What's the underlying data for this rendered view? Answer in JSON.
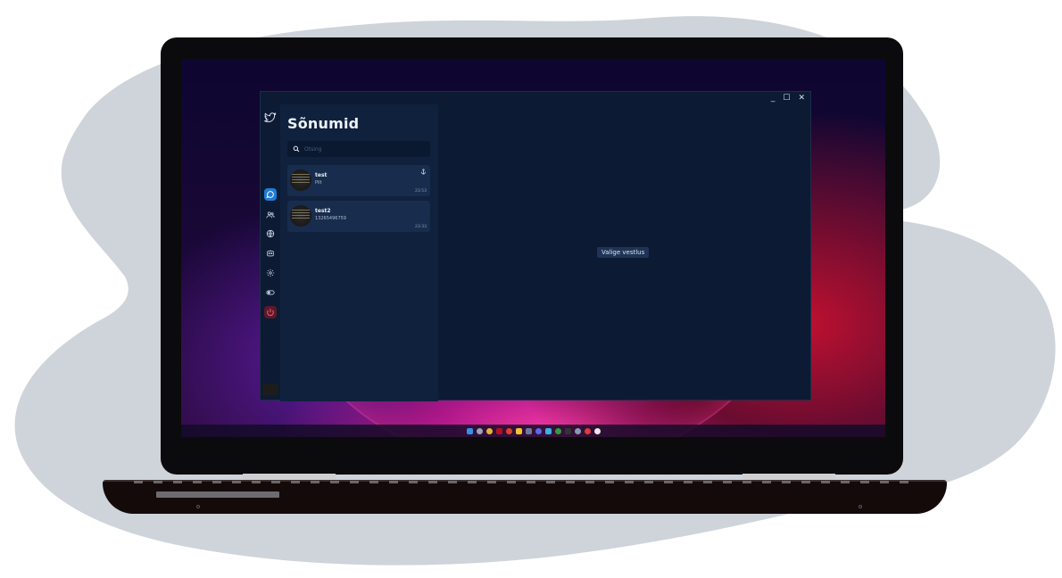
{
  "app": {
    "title": "Sõnumid",
    "search_placeholder": "Otsing",
    "empty_state": "Valige vestlus",
    "window_controls": {
      "minimize": "_",
      "maximize": "☐",
      "close": "✕"
    }
  },
  "rail": {
    "icons": [
      "bird-logo-icon",
      "chat-bubble-icon",
      "users-icon",
      "globe-icon",
      "bot-icon",
      "settings-gear-icon",
      "toggle-icon",
      "power-icon"
    ],
    "active": "chat-bubble-icon"
  },
  "chats": [
    {
      "name": "test",
      "preview": "Pilt",
      "time": "23:53",
      "pinned": true
    },
    {
      "name": "test2",
      "preview": "13265496759",
      "time": "23:33",
      "pinned": false
    }
  ],
  "colors": {
    "accent": "#1f7bd8",
    "window_bg": "#0c1b33",
    "panel_bg": "#10213d",
    "chat_item_bg": "#182c4d",
    "power_bg": "#5a1a2a"
  },
  "taskbar": {
    "icons": [
      "windows-start-icon",
      "settings-icon",
      "chrome-icon",
      "app-icon",
      "app-icon",
      "file-explorer-icon",
      "app-icon",
      "app-icon",
      "app-icon",
      "xbox-icon",
      "app-icon",
      "app-icon",
      "app-icon",
      "app-icon"
    ]
  }
}
